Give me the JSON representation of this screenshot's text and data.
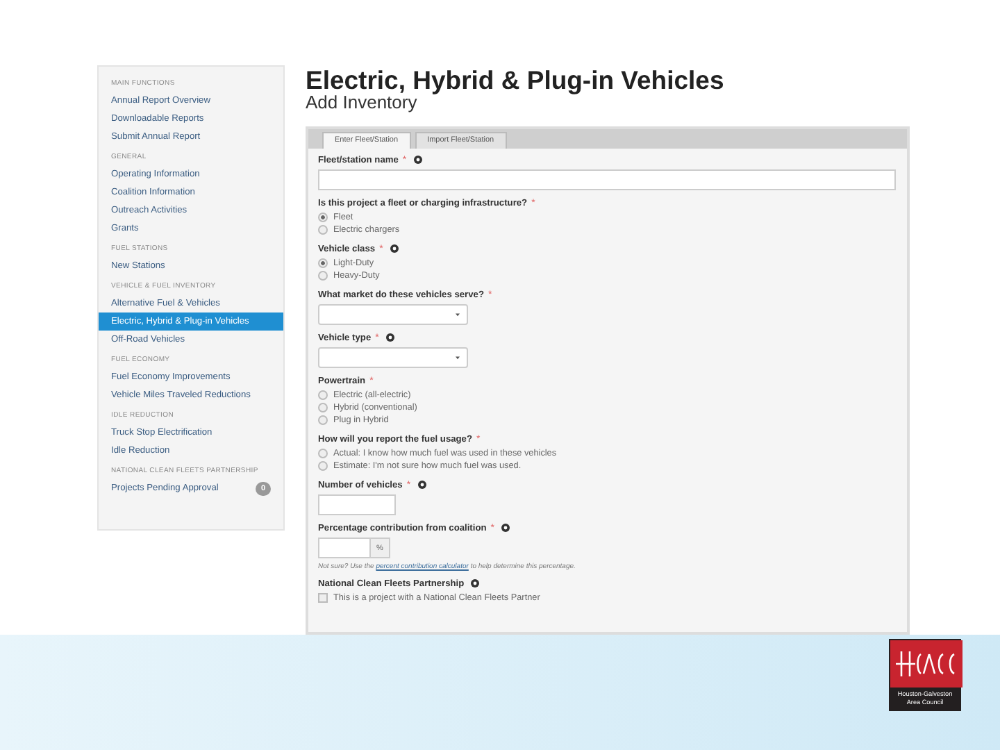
{
  "sidebar": {
    "sections": [
      {
        "header": "MAIN FUNCTIONS",
        "items": [
          {
            "label": "Annual Report Overview",
            "selected": false
          },
          {
            "label": "Downloadable Reports",
            "selected": false
          },
          {
            "label": "Submit Annual Report",
            "selected": false
          }
        ]
      },
      {
        "header": "GENERAL",
        "items": [
          {
            "label": "Operating Information",
            "selected": false
          },
          {
            "label": "Coalition Information",
            "selected": false
          },
          {
            "label": "Outreach Activities",
            "selected": false
          },
          {
            "label": "Grants",
            "selected": false
          }
        ]
      },
      {
        "header": "FUEL STATIONS",
        "items": [
          {
            "label": "New Stations",
            "selected": false
          }
        ]
      },
      {
        "header": "VEHICLE & FUEL INVENTORY",
        "items": [
          {
            "label": "Alternative Fuel & Vehicles",
            "selected": false
          },
          {
            "label": "Electric, Hybrid & Plug-in Vehicles",
            "selected": true
          },
          {
            "label": "Off-Road Vehicles",
            "selected": false
          }
        ]
      },
      {
        "header": "FUEL ECONOMY",
        "items": [
          {
            "label": "Fuel Economy Improvements",
            "selected": false
          },
          {
            "label": "Vehicle Miles Traveled Reductions",
            "selected": false
          }
        ]
      },
      {
        "header": "IDLE REDUCTION",
        "items": [
          {
            "label": "Truck Stop Electrification",
            "selected": false
          },
          {
            "label": "Idle Reduction",
            "selected": false
          }
        ]
      },
      {
        "header": "NATIONAL CLEAN FLEETS PARTNERSHIP",
        "items": [
          {
            "label": "Projects Pending Approval",
            "selected": false,
            "badge": "0"
          }
        ]
      }
    ]
  },
  "title": "Electric, Hybrid & Plug-in Vehicles",
  "subtitle": "Add Inventory",
  "tabs": [
    {
      "label": "Enter Fleet/Station",
      "selected": true
    },
    {
      "label": "Import Fleet/Station",
      "selected": false
    }
  ],
  "fields": [
    {
      "kind": "text",
      "label": "Fleet/station name",
      "required_mark": "*",
      "help": true
    },
    {
      "kind": "radio",
      "label": "Is this project a fleet or charging infrastructure?",
      "required_mark": "*",
      "help": false,
      "options": [
        {
          "label": "Fleet",
          "selected": true
        },
        {
          "label": "Electric chargers",
          "selected": false
        }
      ]
    },
    {
      "kind": "radio",
      "label": "Vehicle class",
      "required_mark": "*",
      "help": true,
      "options": [
        {
          "label": "Light-Duty",
          "selected": true
        },
        {
          "label": "Heavy-Duty",
          "selected": false
        }
      ]
    },
    {
      "kind": "select",
      "label": "What market do these vehicles serve?",
      "required_mark": "*",
      "help": false
    },
    {
      "kind": "select",
      "label": "Vehicle type",
      "required_mark": "*",
      "help": true
    },
    {
      "kind": "radio",
      "label": "Powertrain",
      "required_mark": "*",
      "help": false,
      "options": [
        {
          "label": "Electric (all-electric)",
          "selected": false
        },
        {
          "label": "Hybrid (conventional)",
          "selected": false
        },
        {
          "label": "Plug in Hybrid",
          "selected": false
        }
      ]
    },
    {
      "kind": "radio",
      "label": "How will you report the fuel usage?",
      "required_mark": "*",
      "help": false,
      "options": [
        {
          "label": "Actual: I know how much fuel was used in these vehicles",
          "selected": false
        },
        {
          "label": "Estimate: I'm not sure how much fuel was used.",
          "selected": false
        }
      ]
    },
    {
      "kind": "number",
      "label": "Number of vehicles",
      "required_mark": "*",
      "help": true
    },
    {
      "kind": "percent",
      "label": "Percentage contribution from coalition",
      "required_mark": "*",
      "help": true,
      "addon": "%",
      "note_before": "Not sure? Use the",
      "note_link": "percent contribution calculator",
      "note_after": "to help determine this percentage."
    },
    {
      "kind": "checkbox",
      "label": "National Clean Fleets Partnership",
      "help": true,
      "options": [
        {
          "label": "This is a project with a National Clean Fleets Partner",
          "selected": false
        }
      ]
    }
  ],
  "logo": {
    "caption": "Houston-Galveston Area Council"
  }
}
